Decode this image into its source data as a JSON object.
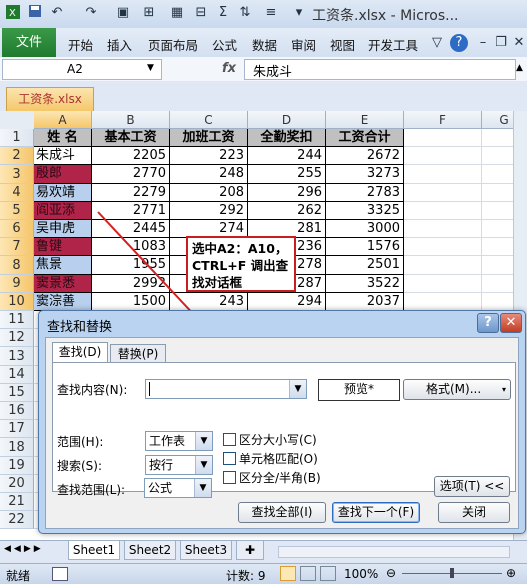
{
  "window": {
    "title": "工资条.xlsx - Micros..."
  },
  "ribbon": {
    "file": "文件",
    "tabs": [
      "开始",
      "插入",
      "页面布局",
      "公式",
      "数据",
      "审阅",
      "视图",
      "开发工具"
    ]
  },
  "formula_bar": {
    "name_box": "A2",
    "fx": "fx",
    "value": "朱成斗"
  },
  "workbook_tab": "工资条.xlsx",
  "columns": [
    "A",
    "B",
    "C",
    "D",
    "E",
    "F",
    "G"
  ],
  "rows": [
    "1",
    "2",
    "3",
    "4",
    "5",
    "6",
    "7",
    "8",
    "9",
    "10",
    "11",
    "12",
    "13",
    "14",
    "15",
    "16",
    "17",
    "18",
    "19",
    "20",
    "21",
    "22"
  ],
  "table": {
    "headers": [
      "姓  名",
      "基本工资",
      "加班工资",
      "全勤奖扣",
      "工资合计"
    ],
    "rows": [
      {
        "name": "朱成斗",
        "v": [
          "2205",
          "223",
          "244",
          "2672"
        ]
      },
      {
        "name": "殷郎",
        "v": [
          "2770",
          "248",
          "255",
          "3273"
        ]
      },
      {
        "name": "易欢靖",
        "v": [
          "2279",
          "208",
          "296",
          "2783"
        ]
      },
      {
        "name": "阎亚添",
        "v": [
          "2771",
          "292",
          "262",
          "3325"
        ]
      },
      {
        "name": "吴申虎",
        "v": [
          "2445",
          "274",
          "281",
          "3000"
        ]
      },
      {
        "name": "鲁键",
        "v": [
          "1083",
          "",
          "236",
          "1576"
        ]
      },
      {
        "name": "焦景",
        "v": [
          "1955",
          "",
          "278",
          "2501"
        ]
      },
      {
        "name": "窦景悉",
        "v": [
          "2992",
          "",
          "287",
          "3522"
        ]
      },
      {
        "name": "窦淙善",
        "v": [
          "1500",
          "243",
          "294",
          "2037"
        ]
      }
    ]
  },
  "callout": {
    "text": "选中A2：A10，CTRL+F 调出查找对话框"
  },
  "dialog": {
    "title": "查找和替换",
    "help": "?",
    "close": "✕",
    "tab_find": "查找(D)",
    "tab_replace": "替换(P)",
    "find_label": "查找内容(N):",
    "find_value": "",
    "preview": "预览*",
    "format_button": "格式(M)...",
    "scope_label": "范围(H):",
    "scope_value": "工作表",
    "search_label": "搜索(S):",
    "search_value": "按行",
    "lookin_label": "查找范围(L):",
    "lookin_value": "公式",
    "match_case": "区分大小写(C)",
    "match_cell": "单元格匹配(O)",
    "match_byte": "区分全/半角(B)",
    "options_button": "选项(T) <<",
    "find_all": "查找全部(I)",
    "find_next": "查找下一个(F)",
    "close_button": "关闭"
  },
  "sheet_tabs": [
    "Sheet1",
    "Sheet2",
    "Sheet3"
  ],
  "status": {
    "ready": "就绪",
    "count": "计数: 9",
    "zoom": "100%"
  },
  "colors": {
    "selected_name_fill": "#b8d0ee",
    "highlight_fill": "#b0244a",
    "callout_border": "#c81e1e",
    "arrow": "#d42020"
  }
}
